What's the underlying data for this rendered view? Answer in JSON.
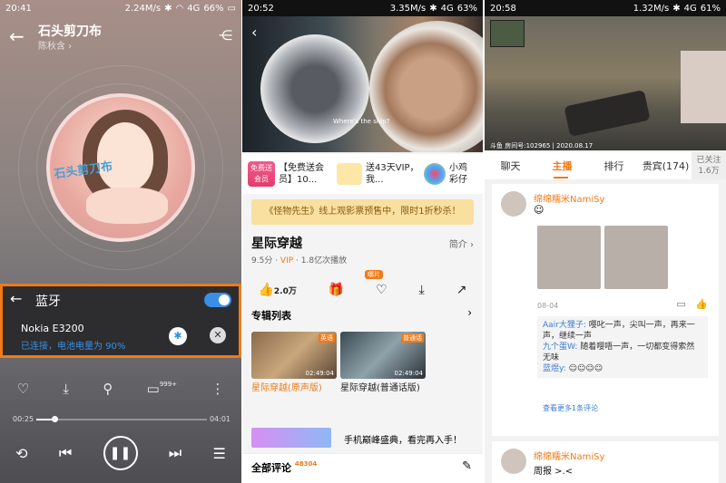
{
  "panel1": {
    "status": {
      "time": "20:41",
      "speed": "2.24M/s",
      "signal": "4G",
      "battery": "66%"
    },
    "song_title": "石头剪刀布",
    "artist": "陈秋含",
    "disc_logo": "石头剪刀布",
    "bluetooth": {
      "title": "蓝牙",
      "device": "Nokia E3200",
      "status": "已连接，电池电量为 90%"
    },
    "comment_badge": "999+",
    "progress": {
      "current": "00:25",
      "total": "04:01",
      "fraction": 0.104
    }
  },
  "panel2": {
    "status": {
      "time": "20:52",
      "speed": "3.35M/s",
      "signal": "4G",
      "battery": "63%"
    },
    "subtitle": "Where's the ship?",
    "promos": [
      {
        "badge": "免费送\n会员",
        "text": "【免费送会员】10..."
      },
      {
        "text": "送43天VIP，我..."
      },
      {
        "text": "小鸡彩仔"
      }
    ],
    "banner": "《怪物先生》线上观影票预售中，限时1折秒杀！",
    "movie": {
      "title": "星际穿越",
      "intro": "简介",
      "score": "9.5分",
      "vip": "VIP",
      "plays": "1.8亿次播放"
    },
    "likes": "2.0万",
    "hongbao": "哪片",
    "section_title": "专辑列表",
    "episodes": [
      {
        "label": "星际穿越(原声版)",
        "tag": "英语",
        "duration": "02:49:04"
      },
      {
        "label": "星际穿越(普通话版)",
        "tag": "普通话",
        "duration": "02:49:04"
      }
    ],
    "ad_text": "手机巅峰盛典，看完再入手！",
    "comments": {
      "label": "全部评论",
      "count": "48304"
    }
  },
  "panel3": {
    "status": {
      "time": "20:58",
      "speed": "1.32M/s",
      "signal": "4G",
      "battery": "61%"
    },
    "stream_caption": "斗鱼 房间号:102965 | 2020.08.17",
    "tabs": [
      "聊天",
      "主播",
      "排行",
      "贵宾(174)"
    ],
    "follow": {
      "label": "已关注",
      "count": "1.6万"
    },
    "post1": {
      "user": "绵绵糯米NamiSy",
      "date": "08-04",
      "replies": [
        {
          "user": "Aair大狸子:",
          "text": "嘤叱一声，尖叫一声，再来一声，继续一声"
        },
        {
          "user": "九个蛋W:",
          "text": "随着嘤唔一声，一切都变得索然无味"
        }
      ],
      "emoji_user": "蓝煜y:",
      "more": "查看更多1条评论"
    },
    "post2": {
      "user": "绵绵糯米NamiSy",
      "text": "周报 >.<"
    }
  }
}
